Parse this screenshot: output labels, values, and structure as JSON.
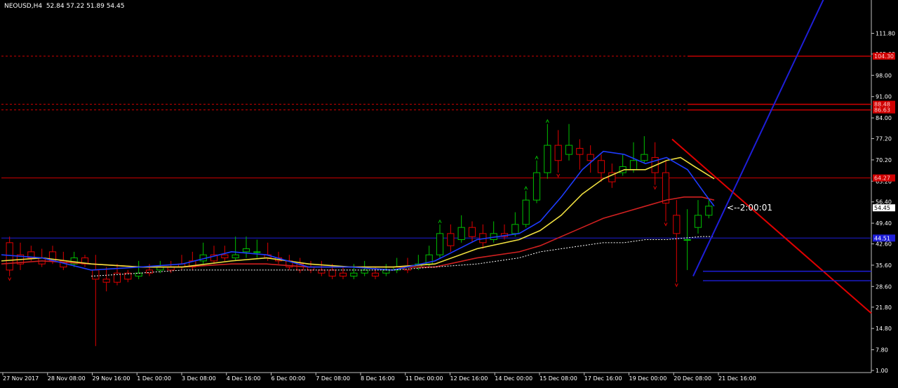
{
  "header": {
    "symbol": "NEOUSD,H4",
    "ohlc": "52.84 57.22 51.89 54.45"
  },
  "countdown": "<--2:00:01",
  "colors": {
    "bull": "#00c000",
    "bear": "#e00000",
    "level": "#d00000",
    "blue": "#1e1ed8",
    "ema_fast": "#1e3cff",
    "ema_mid": "#f0e040",
    "ema_slow": "#d02020",
    "sma": "#ffffff"
  },
  "chart_data": {
    "type": "candlestick",
    "ylim": [
      1.0,
      118.6
    ],
    "y_ticks": [
      "111.80",
      "105.00",
      "98.00",
      "91.00",
      "84.00",
      "77.20",
      "70.20",
      "63.20",
      "56.40",
      "49.40",
      "42.60",
      "35.60",
      "28.60",
      "21.80",
      "14.80",
      "7.80",
      "1.00"
    ],
    "x_ticks": [
      "27 Nov 2017",
      "28 Nov 08:00",
      "29 Nov 16:00",
      "1 Dec 00:00",
      "3 Dec 08:00",
      "4 Dec 16:00",
      "6 Dec 00:00",
      "7 Dec 08:00",
      "8 Dec 16:00",
      "11 Dec 00:00",
      "12 Dec 16:00",
      "14 Dec 00:00",
      "15 Dec 08:00",
      "17 Dec 16:00",
      "19 Dec 00:00",
      "20 Dec 08:00",
      "21 Dec 16:00"
    ],
    "current_price": {
      "label": "54.45",
      "value": 54.45
    },
    "levels": [
      {
        "label": "104.30",
        "value": 104.3,
        "style": "solid-right"
      },
      {
        "label": "88.48",
        "value": 88.48,
        "style": "solid-right"
      },
      {
        "label": "86.63",
        "value": 86.63,
        "style": "solid-right"
      },
      {
        "label": "64.27",
        "value": 64.27,
        "style": "solid-full"
      },
      {
        "label": "44.51",
        "value": 44.51,
        "style": "blue-full"
      }
    ],
    "dashed_levels": [
      104.3,
      88.48,
      86.63
    ],
    "ranges": [
      [
        43,
        34,
        45,
        32
      ],
      [
        39,
        36,
        43,
        34
      ],
      [
        40,
        38,
        42,
        37
      ],
      [
        38,
        36,
        41,
        35
      ],
      [
        40,
        37,
        42,
        36
      ],
      [
        37,
        35,
        40,
        34
      ],
      [
        36,
        38,
        40,
        35
      ],
      [
        38,
        36,
        39,
        35
      ],
      [
        34,
        31,
        39,
        9
      ],
      [
        31,
        30,
        35,
        27
      ],
      [
        33,
        30,
        36,
        29
      ],
      [
        33,
        31,
        34,
        30
      ],
      [
        32,
        33,
        37,
        31
      ],
      [
        34,
        33,
        36,
        32
      ],
      [
        34,
        35,
        37,
        33
      ],
      [
        35,
        34,
        37,
        33
      ],
      [
        36,
        35,
        39,
        34
      ],
      [
        37,
        35,
        40,
        34
      ],
      [
        37,
        39,
        43,
        36
      ],
      [
        39,
        37,
        42,
        36
      ],
      [
        39,
        38,
        42,
        37
      ],
      [
        38,
        39,
        45,
        37
      ],
      [
        40,
        41,
        45,
        38
      ],
      [
        40,
        40,
        44,
        38
      ],
      [
        39,
        38,
        43,
        37
      ],
      [
        38,
        37,
        40,
        36
      ],
      [
        37,
        35,
        39,
        34
      ],
      [
        36,
        34,
        38,
        33
      ],
      [
        35,
        34,
        37,
        33
      ],
      [
        34,
        33,
        37,
        32
      ],
      [
        34,
        32,
        36,
        31
      ],
      [
        33,
        32,
        35,
        31
      ],
      [
        32,
        33,
        36,
        31
      ],
      [
        33,
        34,
        37,
        32
      ],
      [
        33,
        32,
        35,
        31
      ],
      [
        33,
        34,
        36,
        32
      ],
      [
        34,
        35,
        38,
        33
      ],
      [
        35,
        34,
        38,
        33
      ],
      [
        35,
        36,
        39,
        34
      ],
      [
        36,
        39,
        42,
        35
      ],
      [
        39,
        46,
        49,
        38
      ],
      [
        46,
        42,
        49,
        40
      ],
      [
        44,
        48,
        52,
        43
      ],
      [
        48,
        45,
        50,
        43
      ],
      [
        46,
        43,
        49,
        41
      ],
      [
        44,
        46,
        50,
        43
      ],
      [
        46,
        45,
        49,
        44
      ],
      [
        46,
        49,
        53,
        45
      ],
      [
        49,
        57,
        60,
        48
      ],
      [
        57,
        66,
        70,
        56
      ],
      [
        66,
        75,
        82,
        64
      ],
      [
        75,
        70,
        80,
        66
      ],
      [
        72,
        75,
        82,
        70
      ],
      [
        74,
        72,
        77,
        67
      ],
      [
        72,
        70,
        75,
        66
      ],
      [
        70,
        66,
        72,
        63
      ],
      [
        66,
        63,
        69,
        61
      ],
      [
        66,
        68,
        72,
        65
      ],
      [
        67,
        70,
        76,
        66
      ],
      [
        70,
        72,
        78,
        69
      ],
      [
        71,
        66,
        76,
        62
      ],
      [
        66,
        56,
        70,
        50
      ],
      [
        52,
        46,
        57,
        30
      ],
      [
        44,
        44,
        54,
        34
      ],
      [
        48,
        52,
        57,
        46
      ],
      [
        52,
        55,
        57,
        51
      ]
    ],
    "ema_fast": [
      [
        2,
        39
      ],
      [
        60,
        38
      ],
      [
        130,
        34
      ],
      [
        200,
        35
      ],
      [
        260,
        36
      ],
      [
        330,
        40
      ],
      [
        380,
        39
      ],
      [
        440,
        35
      ],
      [
        500,
        35
      ],
      [
        560,
        34
      ],
      [
        620,
        37
      ],
      [
        680,
        44
      ],
      [
        740,
        46
      ],
      [
        770,
        50
      ],
      [
        800,
        58
      ],
      [
        830,
        67
      ],
      [
        860,
        73
      ],
      [
        890,
        72
      ],
      [
        920,
        69
      ],
      [
        950,
        71
      ],
      [
        980,
        67
      ],
      [
        1005,
        59
      ],
      [
        1018,
        55
      ]
    ],
    "ema_mid": [
      [
        2,
        37
      ],
      [
        60,
        38
      ],
      [
        130,
        36
      ],
      [
        200,
        35
      ],
      [
        260,
        35
      ],
      [
        330,
        37
      ],
      [
        380,
        38
      ],
      [
        440,
        36
      ],
      [
        500,
        35
      ],
      [
        560,
        35
      ],
      [
        620,
        36
      ],
      [
        680,
        41
      ],
      [
        740,
        44
      ],
      [
        770,
        47
      ],
      [
        800,
        52
      ],
      [
        830,
        59
      ],
      [
        860,
        64
      ],
      [
        890,
        67
      ],
      [
        920,
        67
      ],
      [
        950,
        70
      ],
      [
        970,
        71
      ],
      [
        990,
        68
      ],
      [
        1018,
        64
      ]
    ],
    "ema_slow": [
      [
        2,
        36
      ],
      [
        60,
        37
      ],
      [
        130,
        36
      ],
      [
        200,
        35
      ],
      [
        260,
        35
      ],
      [
        330,
        36
      ],
      [
        380,
        36
      ],
      [
        440,
        35
      ],
      [
        500,
        35
      ],
      [
        560,
        35
      ],
      [
        620,
        35
      ],
      [
        680,
        38
      ],
      [
        740,
        40
      ],
      [
        770,
        42
      ],
      [
        800,
        45
      ],
      [
        830,
        48
      ],
      [
        860,
        51
      ],
      [
        890,
        53
      ],
      [
        920,
        55
      ],
      [
        950,
        57
      ],
      [
        975,
        58
      ],
      [
        1000,
        58
      ],
      [
        1018,
        57
      ]
    ],
    "sma": [
      [
        130,
        32
      ],
      [
        200,
        33
      ],
      [
        260,
        34
      ],
      [
        330,
        34
      ],
      [
        380,
        34
      ],
      [
        440,
        34
      ],
      [
        500,
        34
      ],
      [
        560,
        34
      ],
      [
        620,
        35
      ],
      [
        680,
        36
      ],
      [
        740,
        38
      ],
      [
        770,
        40
      ],
      [
        800,
        41
      ],
      [
        830,
        42
      ],
      [
        860,
        43
      ],
      [
        890,
        43
      ],
      [
        920,
        44
      ],
      [
        950,
        44
      ],
      [
        1000,
        45
      ],
      [
        1018,
        45
      ]
    ],
    "trend_down": {
      "from": [
        958,
        77.0
      ],
      "to": [
        1242,
        19.8
      ]
    },
    "trend_up": {
      "from": [
        988,
        32.0
      ],
      "to": [
        1178,
        125.0
      ]
    },
    "short_lines": [
      {
        "from": [
          1002,
          33.6
        ],
        "to": [
          1242,
          33.6
        ]
      },
      {
        "from": [
          1002,
          30.5
        ],
        "to": [
          1242,
          30.5
        ]
      }
    ]
  }
}
